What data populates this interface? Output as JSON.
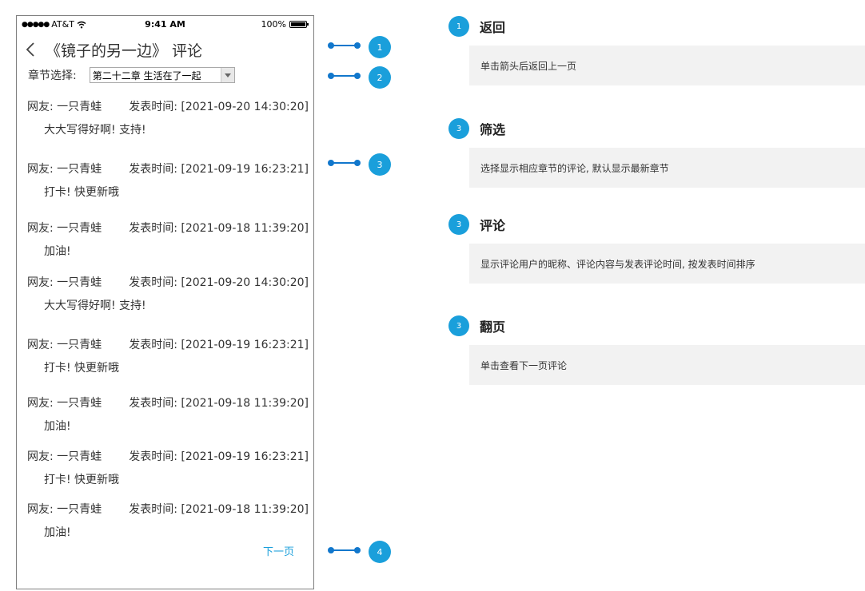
{
  "statusbar": {
    "carrier": "AT&T",
    "time": "9:41 AM",
    "battery": "100%"
  },
  "nav": {
    "title": "《镜子的另一边》 评论"
  },
  "chapter": {
    "label": "章节选择:",
    "selected": "第二十二章 生活在了一起"
  },
  "comments": [
    {
      "user_label": "网友: 一只青蛙",
      "time_label": "发表时间: [2021-09-20 14:30:20]",
      "body": "大大写得好啊! 支持!"
    },
    {
      "user_label": "网友: 一只青蛙",
      "time_label": "发表时间: [2021-09-19 16:23:21]",
      "body": "打卡! 快更新哦"
    },
    {
      "user_label": "网友: 一只青蛙",
      "time_label": "发表时间: [2021-09-18 11:39:20]",
      "body": "加油!"
    },
    {
      "user_label": "网友: 一只青蛙",
      "time_label": "发表时间: [2021-09-20 14:30:20]",
      "body": "大大写得好啊! 支持!"
    },
    {
      "user_label": "网友: 一只青蛙",
      "time_label": "发表时间: [2021-09-19 16:23:21]",
      "body": "打卡! 快更新哦"
    },
    {
      "user_label": "网友: 一只青蛙",
      "time_label": "发表时间: [2021-09-18 11:39:20]",
      "body": "加油!"
    },
    {
      "user_label": "网友: 一只青蛙",
      "time_label": "发表时间: [2021-09-19 16:23:21]",
      "body": "打卡! 快更新哦"
    },
    {
      "user_label": "网友: 一只青蛙",
      "time_label": "发表时间: [2021-09-18 11:39:20]",
      "body": "加油!"
    }
  ],
  "pagination": {
    "next_label": "下一页"
  },
  "callouts": [
    "1",
    "2",
    "3",
    "4"
  ],
  "annotations": [
    {
      "num": "1",
      "title": "返回",
      "desc": "单击箭头后返回上一页"
    },
    {
      "num": "3",
      "title": "筛选",
      "desc": "选择显示相应章节的评论, 默认显示最新章节"
    },
    {
      "num": "3",
      "title": "评论",
      "desc": "显示评论用户的昵称、评论内容与发表评论时间, 按发表时间排序"
    },
    {
      "num": "3",
      "title": "翻页",
      "desc": "单击查看下一页评论"
    }
  ],
  "colors": {
    "accent": "#1a9fdb",
    "connector": "#1177cc",
    "panel_bg": "#f2f2f2"
  }
}
